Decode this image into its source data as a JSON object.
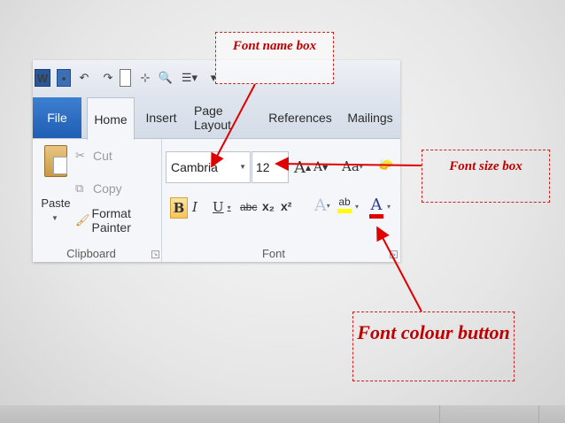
{
  "qat": {
    "app_icon_label": "W",
    "icons": [
      "word-icon",
      "save-icon",
      "undo-icon",
      "redo-icon",
      "new-document-icon",
      "structure-icon",
      "print-preview-icon",
      "list-icon"
    ]
  },
  "tabs": [
    {
      "label": "File"
    },
    {
      "label": "Home"
    },
    {
      "label": "Insert"
    },
    {
      "label": "Page Layout"
    },
    {
      "label": "References"
    },
    {
      "label": "Mailings"
    }
  ],
  "clipboard": {
    "paste_label": "Paste",
    "cut_label": "Cut",
    "copy_label": "Copy",
    "format_painter_label": "Format Painter",
    "group_label": "Clipboard"
  },
  "font": {
    "font_name": "Cambria",
    "font_size": "12",
    "group_label": "Font",
    "grow_glyph": "A",
    "shrink_glyph": "A",
    "change_case_glyph": "Aa",
    "bold_glyph": "B",
    "italic_glyph": "I",
    "underline_glyph": "U",
    "strike_glyph": "abc",
    "subscript_glyph": "x₂",
    "superscript_glyph": "x²",
    "text_effects_glyph": "A",
    "highlight_glyph": "ab",
    "font_colour_glyph": "A",
    "highlight_color": "#ffff00",
    "font_colour_color": "#e00000"
  },
  "callouts": {
    "font_name_box": "Font name box",
    "font_size_box": "Font size box",
    "font_colour_button": "Font colour button"
  },
  "colors": {
    "callout_red": "#c00000",
    "file_tab_blue": "#2b6cc4"
  }
}
